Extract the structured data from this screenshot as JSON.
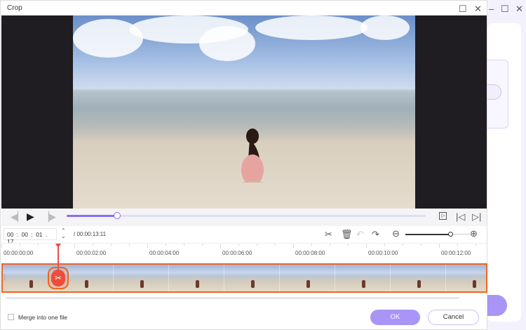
{
  "dialog": {
    "title": "Crop",
    "maximize_icon": "square-icon",
    "close_icon": "close-icon"
  },
  "background_window": {
    "minimize_icon": "minimize-icon",
    "maximize_icon": "square-icon",
    "close_icon": "close-icon"
  },
  "player": {
    "progress_fraction": 0.14
  },
  "time": {
    "current": "00 : 00 : 01 . 17",
    "total": "/ 00:00:13:11"
  },
  "toolbar": {
    "zoom_level_fraction": 0.7
  },
  "ruler": {
    "labels": [
      "00:00:00:00",
      "00:00:02:00",
      "00:00:04:00",
      "00:00:06:00",
      "00:00:08:00",
      "00:00:10:00",
      "00:00:12:00"
    ]
  },
  "footer": {
    "merge_label": "Merge into one file",
    "merge_checked": false,
    "ok_label": "OK",
    "cancel_label": "Cancel"
  },
  "colors": {
    "accent": "#a995f5",
    "timeline_border": "#f06420",
    "playhead": "#ef4b4b"
  }
}
